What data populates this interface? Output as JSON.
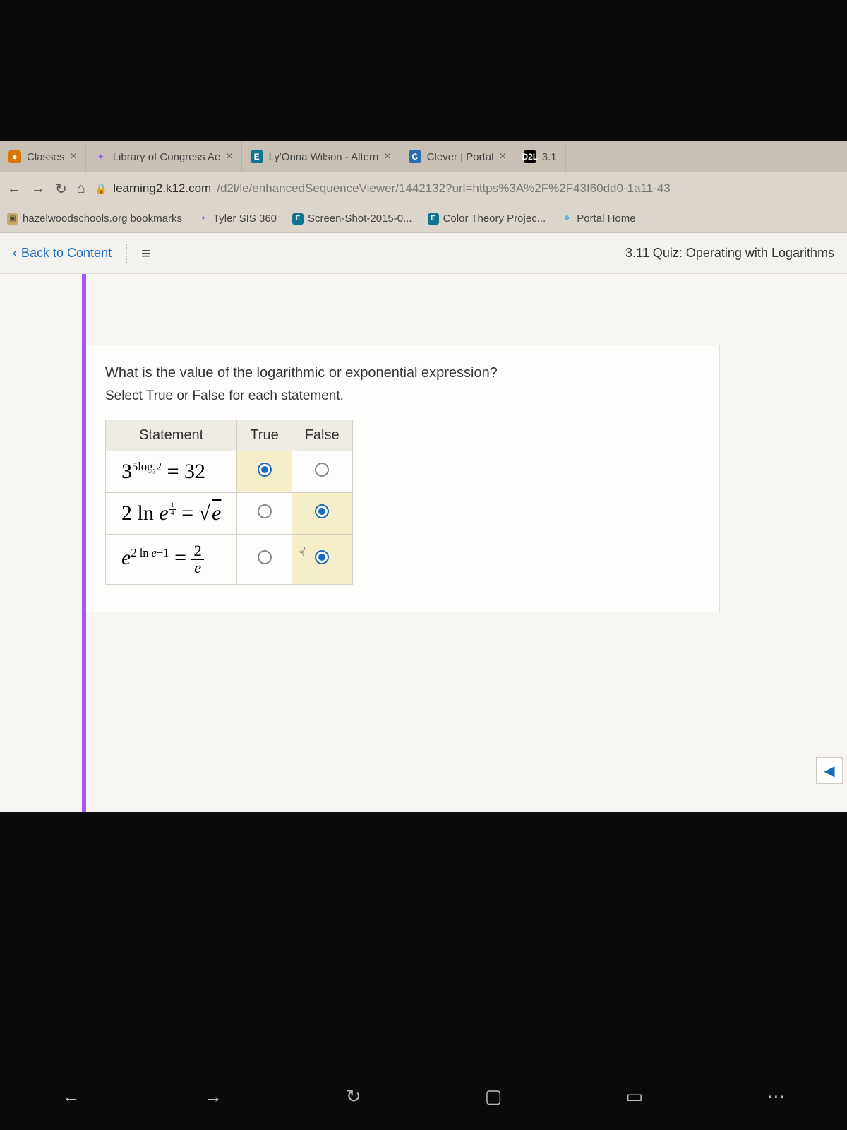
{
  "tabs": [
    {
      "label": "Classes",
      "icon": ""
    },
    {
      "label": "Library of Congress Ae",
      "icon": "✦"
    },
    {
      "label": "Ly'Onna Wilson - Altern",
      "icon": "E"
    },
    {
      "label": "Clever | Portal",
      "icon": "C"
    },
    {
      "label": "3.1",
      "icon": "D2L"
    }
  ],
  "url": {
    "domain": "learning2.k12.com",
    "path": "/d2l/le/enhancedSequenceViewer/1442132?url=https%3A%2F%2F43f60dd0-1a11-43"
  },
  "bookmarks": [
    {
      "label": "hazelwoodschools.org bookmarks"
    },
    {
      "label": "Tyler SIS 360"
    },
    {
      "label": "Screen-Shot-2015-0..."
    },
    {
      "label": "Color Theory Projec..."
    },
    {
      "label": "Portal Home"
    }
  ],
  "header": {
    "back": "Back to Content",
    "title": "3.11 Quiz: Operating with Logarithms"
  },
  "quiz": {
    "prompt": "What is the value of the logarithmic or exponential expression?",
    "sub": "Select True or False for each statement.",
    "cols": {
      "stmt": "Statement",
      "true": "True",
      "false": "False"
    },
    "rows": [
      {
        "selected": "true"
      },
      {
        "selected": "false"
      },
      {
        "selected": "false"
      }
    ]
  }
}
